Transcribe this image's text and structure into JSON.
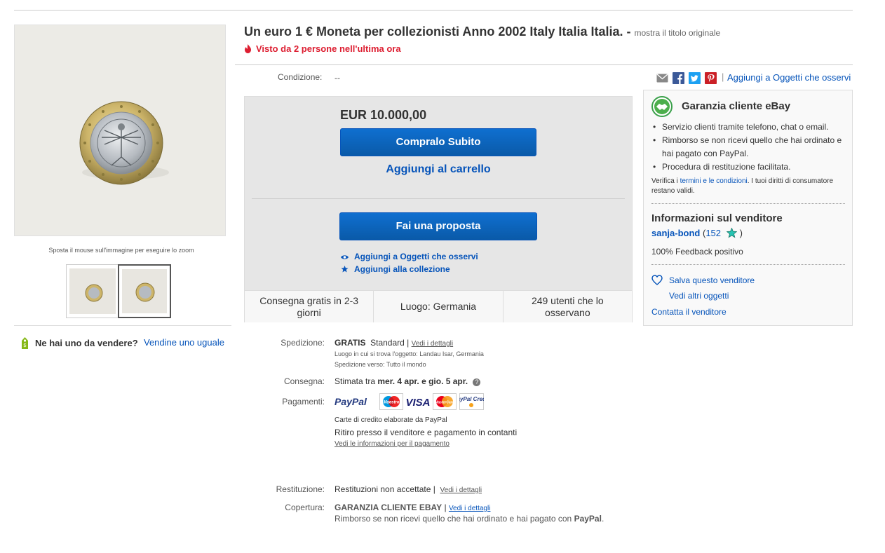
{
  "left": {
    "zoom_hint": "Sposta il mouse sull'immagine per eseguire lo zoom",
    "sell_question": "Ne hai uno da vendere?",
    "sell_link": "Vendine uno uguale"
  },
  "header": {
    "title": "Un euro 1 € Moneta per collezionisti Anno 2002 Italy Italia Italia. -",
    "original_title_link": "mostra il titolo originale",
    "seen": "Visto da 2 persone nell'ultima ora",
    "condition_label": "Condizione:",
    "condition_value": "--",
    "separator": "|",
    "watch_link": "Aggiungi a Oggetti che osservi"
  },
  "buybox": {
    "price": "EUR 10.000,00",
    "buy_now": "Compralo Subito",
    "add_to_cart": "Aggiungi al carrello",
    "make_offer": "Fai una proposta",
    "add_watch": "Aggiungi a Oggetti che osservi",
    "add_collection": "Aggiungi alla collezione",
    "delivery": "Consegna gratis in 2-3 giorni",
    "location": "Luogo: Germania",
    "watchers": "249 utenti che lo osservano"
  },
  "details": {
    "shipping_label": "Spedizione:",
    "shipping_free": "GRATIS",
    "shipping_type": "Standard |",
    "shipping_link": "Vedi i dettagli",
    "item_location": "Luogo in cui si trova l'oggetto:  Landau Isar, Germania",
    "ships_to": "Spedizione verso:  Tutto il mondo",
    "delivery_label": "Consegna:",
    "delivery_prefix": "Stimata tra",
    "delivery_dates": "mer. 4 apr. e gio. 5 apr.",
    "delivery_help": "?",
    "payments_label": "Pagamenti:",
    "payments_logos": [
      "PayPal",
      "Maestro",
      "VISA",
      "MasterCard",
      "PayPal Credit"
    ],
    "paypal_credit_note": "Carte di credito elaborate da PayPal",
    "pickup_note": "Ritiro presso il venditore e pagamento in contanti",
    "payment_info_link": "Vedi le informazioni per il pagamento",
    "returns_label": "Restituzione:",
    "returns_value": "Restituzioni non accettate |",
    "returns_link": "Vedi i dettagli",
    "coverage_label": "Copertura:",
    "coverage_value": "GARANZIA CLIENTE EBAY",
    "coverage_sep": "|",
    "coverage_link": "Vedi i dettagli",
    "coverage_text": "Rimborso se non ricevi quello che hai ordinato e hai pagato con",
    "coverage_paypal": "PayPal",
    "coverage_end": "."
  },
  "guarantee": {
    "title": "Garanzia cliente eBay",
    "items": [
      "Servizio clienti tramite telefono, chat o email.",
      "Rimborso se non ricevi quello che hai ordinato e hai pagato con PayPal.",
      "Procedura di restituzione facilitata."
    ],
    "note_prefix": "Verifica i",
    "note_link": "termini e le condizioni",
    "note_suffix": ". I tuoi diritti di consumatore restano validi."
  },
  "seller": {
    "title": "Informazioni sul venditore",
    "name": "sanja-bond",
    "score_open": "(",
    "score": "152",
    "score_close": ")",
    "feedback": "100% Feedback positivo",
    "save": "Salva questo venditore",
    "more": "Vedi altri oggetti",
    "contact": "Contatta il venditore"
  },
  "colors": {
    "link": "#0654ba",
    "alert": "#dd1e31",
    "button": "#0a5aa8",
    "star": "#26c4b2"
  }
}
